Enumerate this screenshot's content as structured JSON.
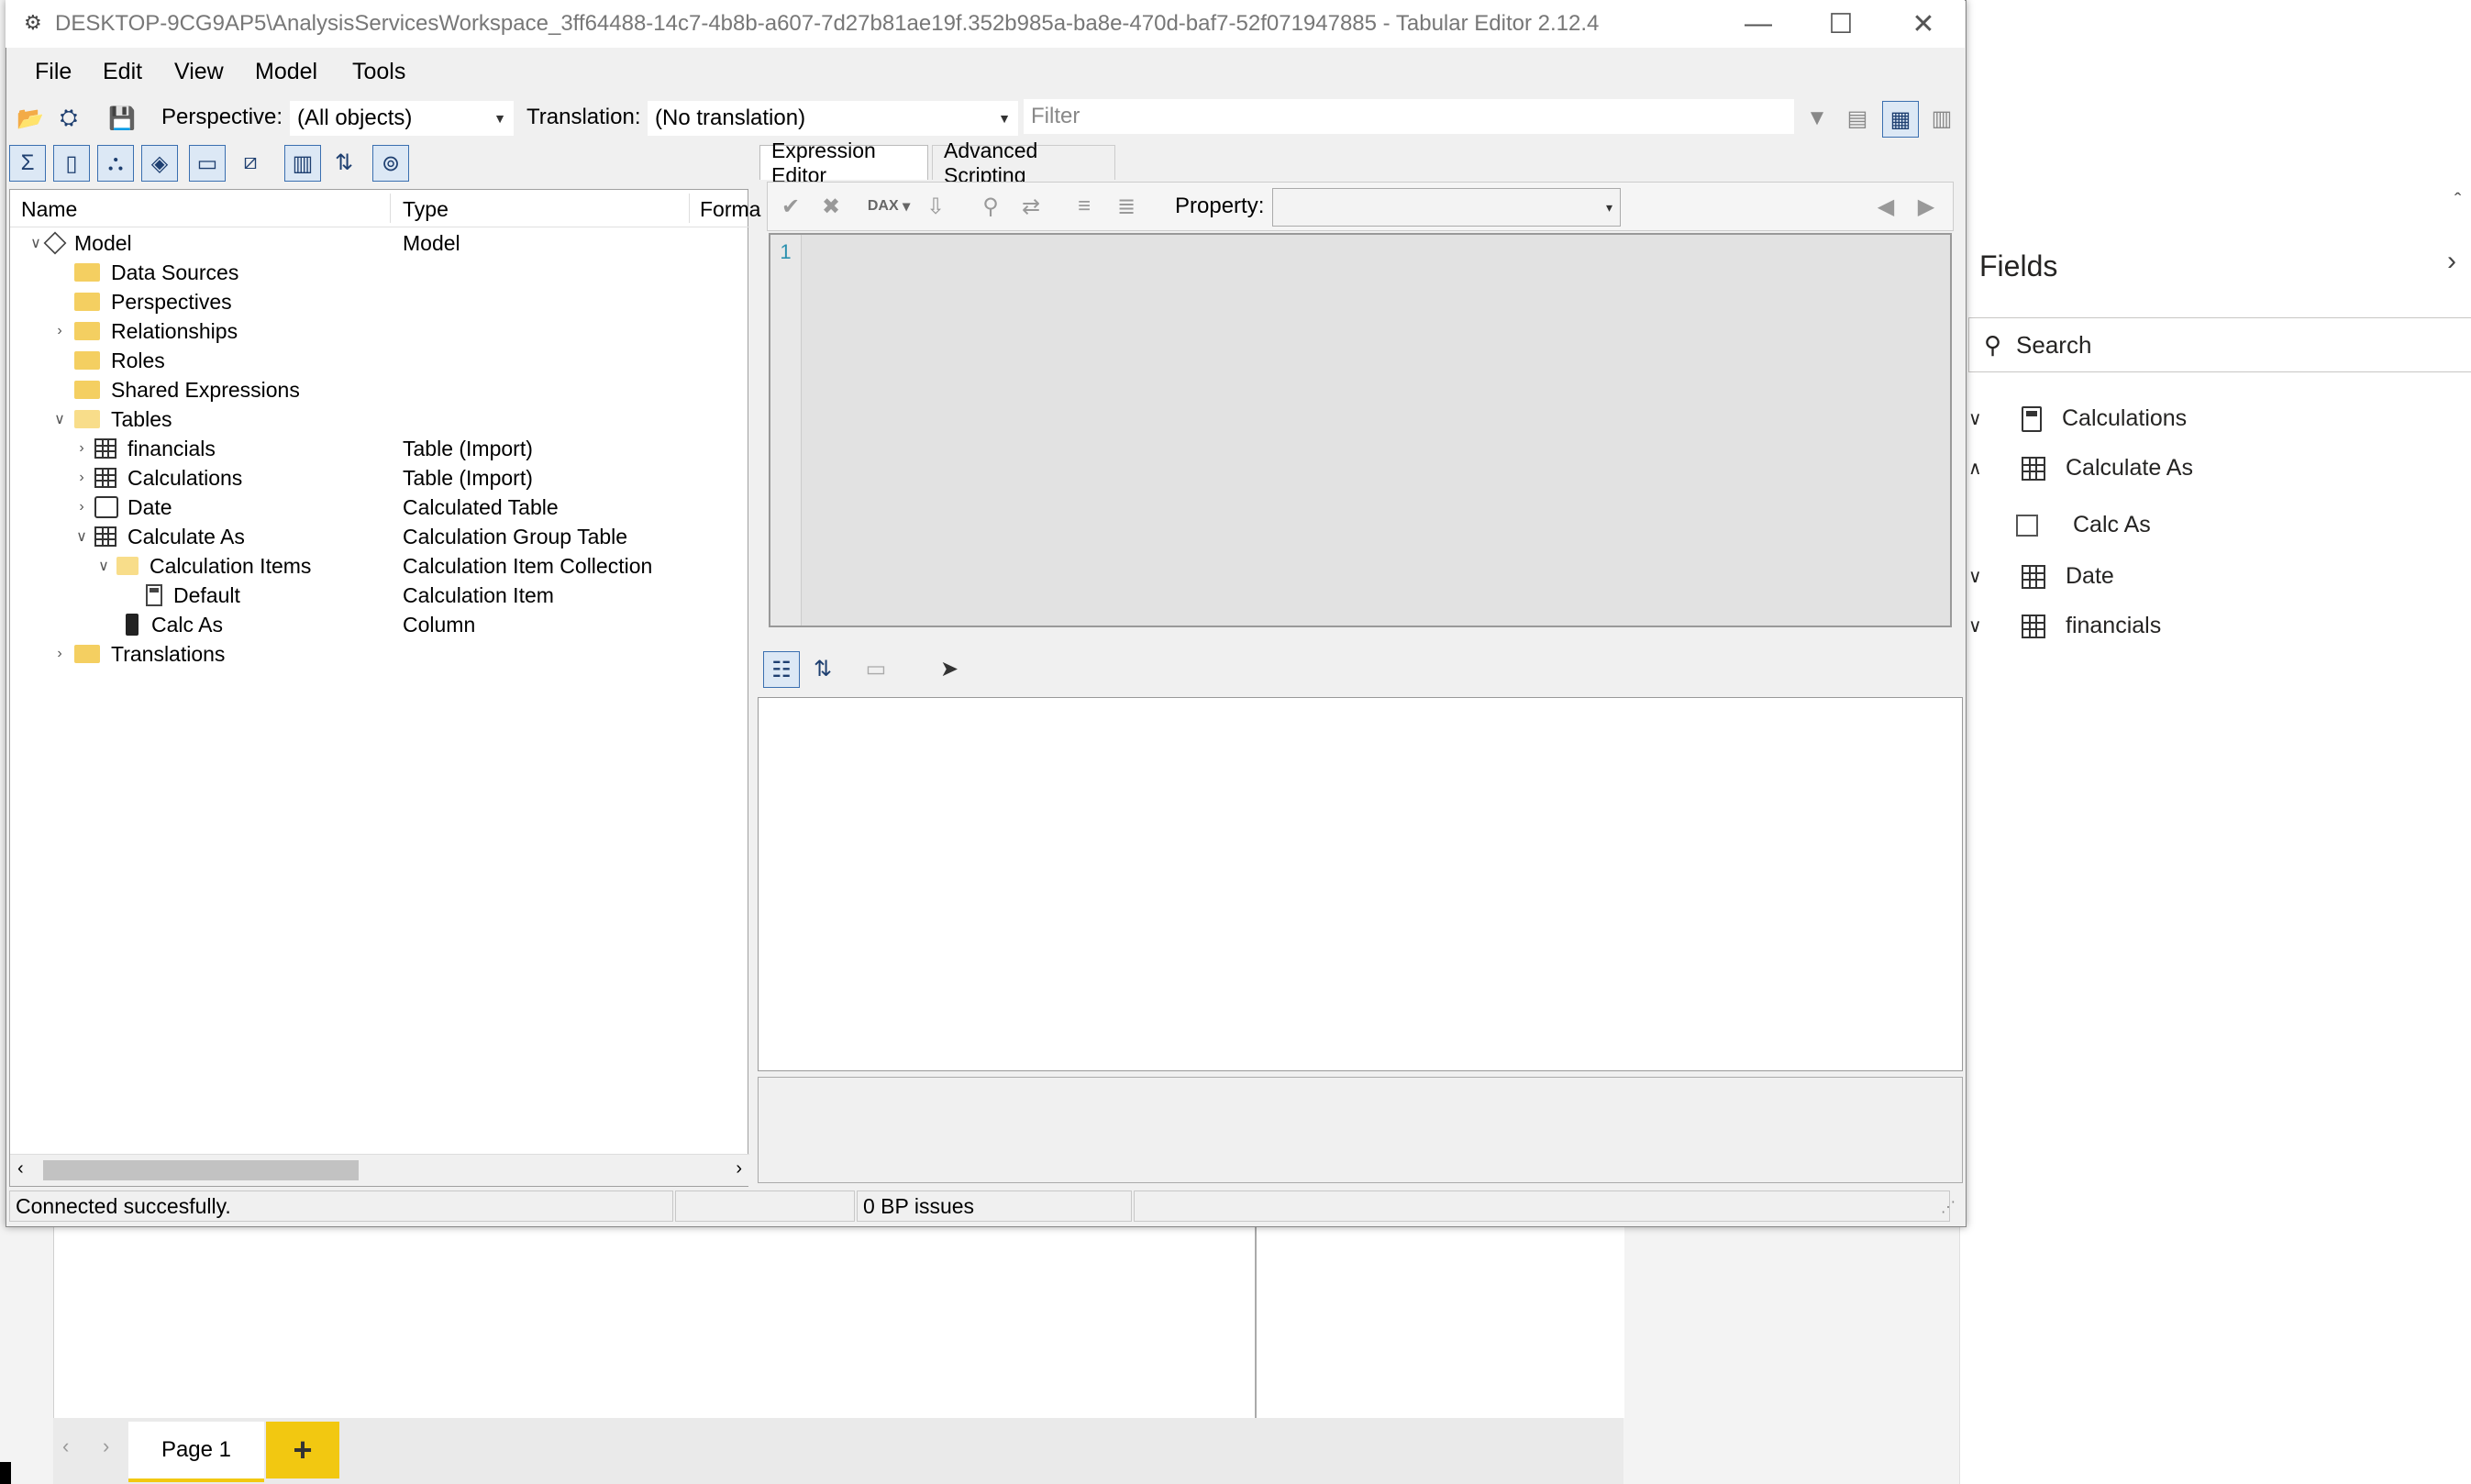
{
  "window": {
    "title": "DESKTOP-9CG9AP5\\AnalysisServicesWorkspace_3ff64488-14c7-4b8b-a607-7d27b81ae19f.352b985a-ba8e-470d-baf7-52f071947885 - Tabular Editor 2.12.4",
    "minimize": "—",
    "maximize": "☐",
    "close": "✕"
  },
  "menu": [
    "File",
    "Edit",
    "View",
    "Model",
    "Tools"
  ],
  "toolbar": {
    "perspective_label": "Perspective:",
    "perspective_value": "(All objects)",
    "translation_label": "Translation:",
    "translation_value": "(No translation)",
    "filter_placeholder": "Filter"
  },
  "tree": {
    "headers": [
      "Name",
      "Type",
      "Forma"
    ],
    "rows": [
      {
        "name": "Model",
        "type": "Model"
      },
      {
        "name": "Data Sources",
        "type": ""
      },
      {
        "name": "Perspectives",
        "type": ""
      },
      {
        "name": "Relationships",
        "type": ""
      },
      {
        "name": "Roles",
        "type": ""
      },
      {
        "name": "Shared Expressions",
        "type": ""
      },
      {
        "name": "Tables",
        "type": ""
      },
      {
        "name": "financials",
        "type": "Table (Import)"
      },
      {
        "name": "Calculations",
        "type": "Table (Import)"
      },
      {
        "name": "Date",
        "type": "Calculated Table"
      },
      {
        "name": "Calculate As",
        "type": "Calculation Group Table"
      },
      {
        "name": "Calculation Items",
        "type": "Calculation Item Collection"
      },
      {
        "name": "Default",
        "type": "Calculation Item"
      },
      {
        "name": "Calc As",
        "type": "Column"
      },
      {
        "name": "Translations",
        "type": ""
      }
    ]
  },
  "editor": {
    "tabs": [
      "Expression Editor",
      "Advanced Scripting"
    ],
    "property_label": "Property:",
    "property_value": "",
    "dax_label": "DAX",
    "line_number": "1"
  },
  "status": {
    "message": "Connected succesfully.",
    "bp_issues": "0 BP issues"
  },
  "fields_pane": {
    "title": "Fields",
    "search_placeholder": "Search",
    "items": [
      {
        "label": "Calculations"
      },
      {
        "label": "Calculate As"
      },
      {
        "label": "Calc As"
      },
      {
        "label": "Date"
      },
      {
        "label": "financials"
      }
    ]
  },
  "report": {
    "page_tab": "Page 1",
    "add_page": "+"
  }
}
